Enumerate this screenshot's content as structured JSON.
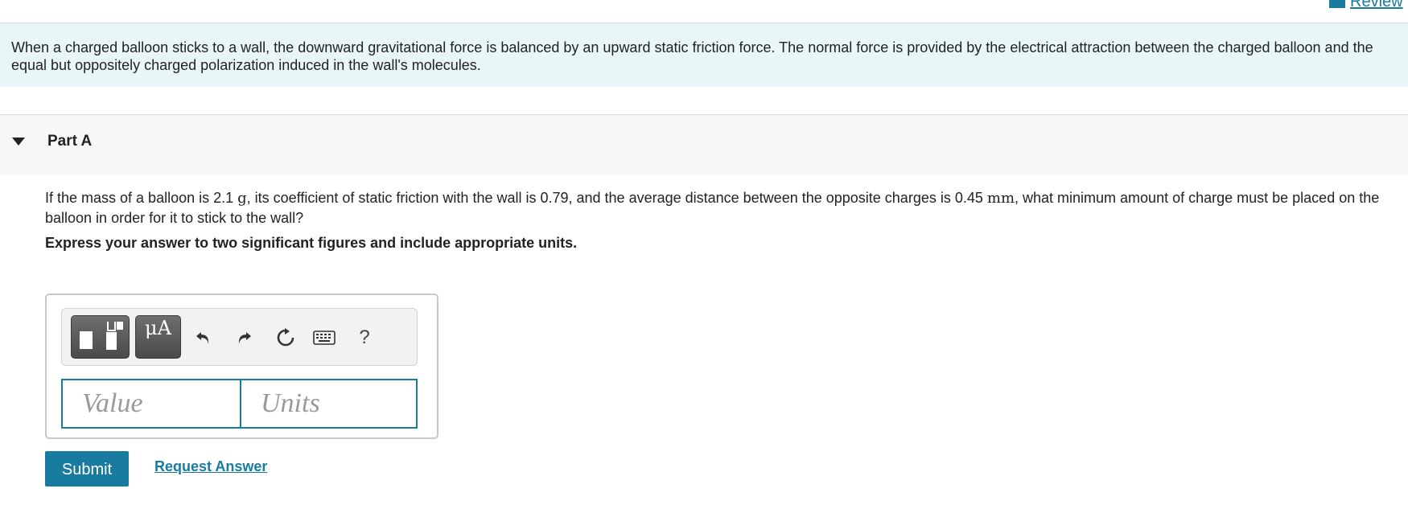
{
  "header": {
    "review_link": "Review"
  },
  "intro": {
    "text": "When a charged balloon sticks to a wall, the downward gravitational force is balanced by an upward static friction force. The normal force is provided by the electrical attraction between the charged balloon and the equal but oppositely charged polarization induced in the wall's molecules."
  },
  "part": {
    "title": "Part A",
    "question": {
      "seg1": "If the mass of a balloon is 2.1 ",
      "unit_mass": "g",
      "seg2": ", its coefficient of static friction with the wall is 0.79, and the average distance between the opposite charges is 0.45 ",
      "unit_distance": "mm",
      "seg3": ", what minimum amount of charge must be placed on the balloon in order for it to stick to the wall?"
    },
    "instruction": "Express your answer to two significant figures and include appropriate units."
  },
  "toolbar": {
    "mu_label": "μA",
    "help_label": "?",
    "icons": [
      "templates-icon",
      "undo-icon",
      "redo-icon",
      "reset-icon",
      "keyboard-icon",
      "help-icon"
    ]
  },
  "inputs": {
    "value_placeholder": "Value",
    "units_placeholder": "Units",
    "value": "",
    "units": ""
  },
  "actions": {
    "submit_label": "Submit",
    "request_answer_label": "Request Answer"
  },
  "colors": {
    "accent": "#1a7ba0",
    "intro_bg": "#e8f6f7",
    "part_bg": "#f7f7f7"
  }
}
